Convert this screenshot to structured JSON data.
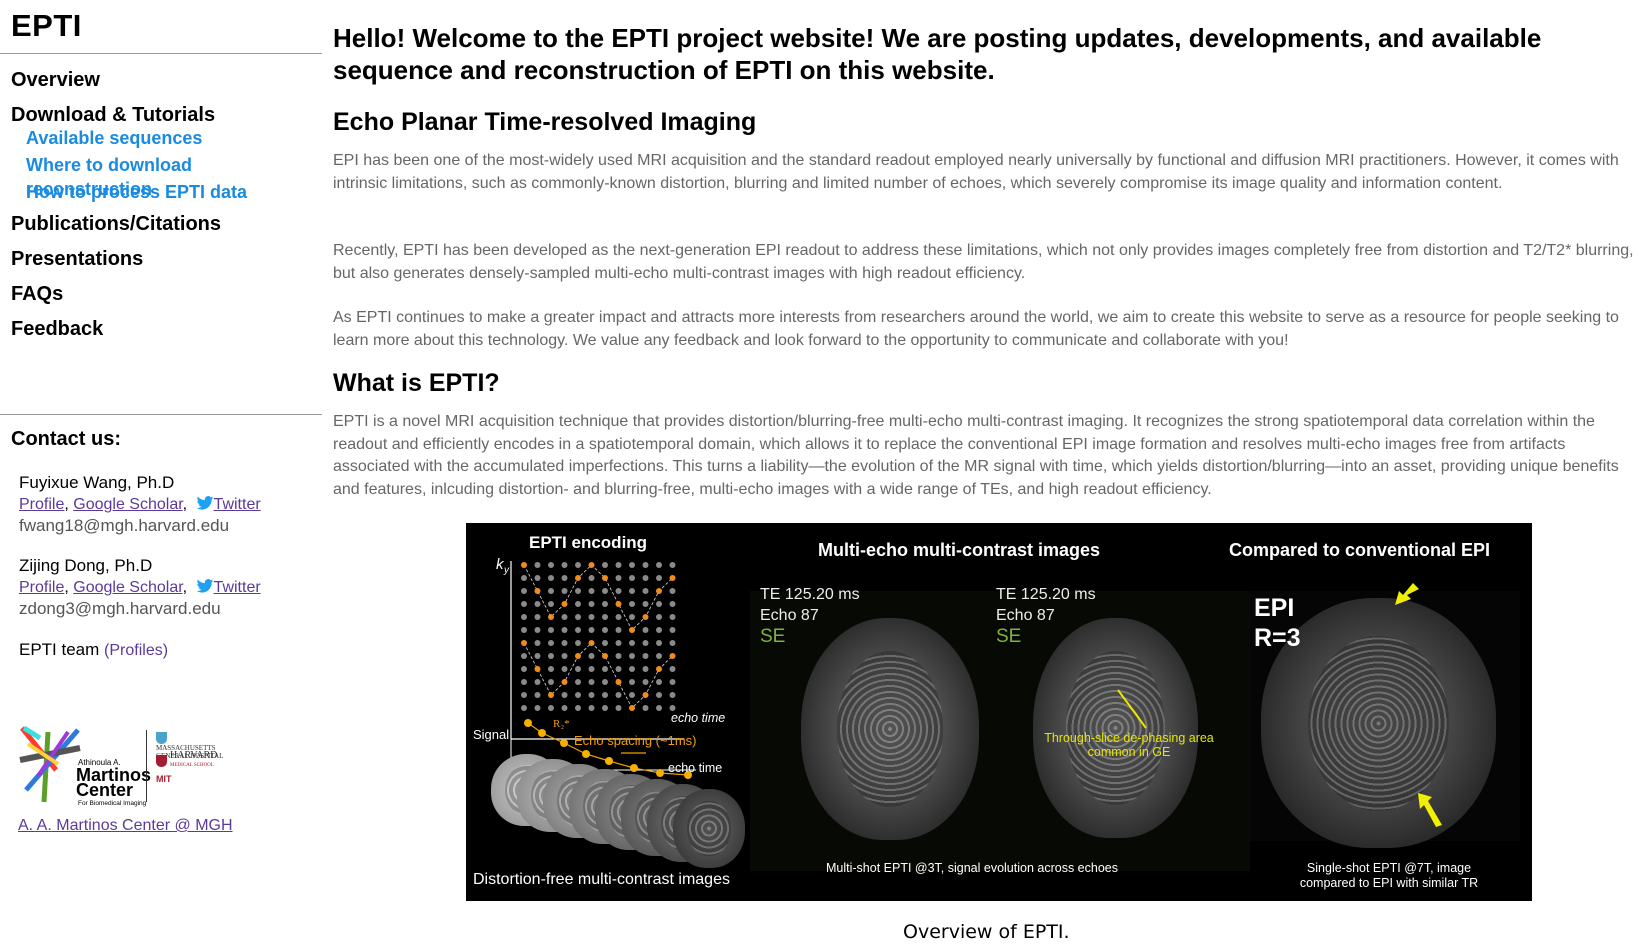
{
  "sidebar": {
    "site_title": "EPTI",
    "nav": [
      {
        "label": "Overview"
      },
      {
        "label": "Download & Tutorials"
      }
    ],
    "sub_nav": [
      {
        "label": "Available sequences"
      },
      {
        "label": "Where to download reconstruction"
      },
      {
        "label": "How to process EPTI data"
      }
    ],
    "nav_after": [
      {
        "label": "Publications/Citations"
      },
      {
        "label": "Presentations"
      },
      {
        "label": "FAQs"
      },
      {
        "label": "Feedback"
      }
    ],
    "contact_title": "Contact us:",
    "contacts": [
      {
        "name": "Fuyixue Wang, Ph.D",
        "profile": "Profile",
        "scholar": "Google Scholar",
        "twitter": "Twitter",
        "email": "fwang18@mgh.harvard.edu"
      },
      {
        "name": "Zijing Dong, Ph.D",
        "profile": "Profile",
        "scholar": "Google Scholar",
        "twitter": "Twitter",
        "email": "zdong3@mgh.harvard.edu"
      }
    ],
    "team_label": "EPTI team",
    "team_link": "(Profiles)",
    "logo": {
      "small": "Athinoula A.",
      "line1": "Martinos",
      "line2": "Center",
      "sub": "For Biomedical Imaging",
      "inst1a": "MASSACHUSETTS",
      "inst1b": "GENERAL HOSPITAL",
      "inst2a": "HARVARD",
      "inst2b": "MEDICAL SCHOOL",
      "inst3": "MIT"
    },
    "martinos_link": "A. A. Martinos Center @ MGH",
    "colors": {
      "link": "#5b3a99",
      "subnav": "#1a8be0",
      "twitter": "#1da1f2"
    }
  },
  "main": {
    "welcome": "Hello! Welcome to the EPTI project website! We are posting updates, developments, and available sequence and reconstruction of EPTI on this website.",
    "section1_title": "Echo Planar Time-resolved Imaging",
    "section1_paras": [
      "EPI has been one of the most-widely used MRI acquisition and the standard readout employed nearly universally by functional and diffusion MRI practitioners. However, it comes with intrinsic limitations, such as commonly-known distortion, blurring and limited number of echoes, which severely compromise its image quality and information content.",
      "Recently, EPTI has been developed as the next-generation EPI readout to address these limitations, which not only provides images completely free from distortion and T2/T2* blurring, but also generates densely-sampled multi-echo multi-contrast images with high readout efficiency.",
      "As EPTI continues to make a greater impact and attracts more interests from researchers around the world, we aim to create this website to serve as a resource for people seeking to learn more about this technology. We value any feedback and look forward to the opportunity to communicate and collaborate with you!"
    ],
    "section2_title": "What is EPTI?",
    "section2_para": "EPTI is a novel MRI acquisition technique that provides distortion/blurring-free multi-echo multi-contrast imaging. It recognizes the strong spatiotemporal data correlation within the readout and efficiently encodes in a spatiotemporal domain, which allows it to replace the conventional EPI image formation and resolves multi-echo images free from artifacts associated with the accumulated imperfections. This turns a liability—the evolution of the MR signal with time, which yields distortion/blurring—into an asset, providing unique benefits and features, inlcuding distortion- and blurring-free, multi-echo images with a wide range of TEs, and high readout efficiency.",
    "figure": {
      "encoding_title": "EPTI encoding",
      "ky_label": "ky",
      "echo_time_label": "echo time",
      "signal_label": "Signal",
      "r2_label": "R2*",
      "echo_spacing": "Echo spacing (~1ms)",
      "distortion_caption": "Distortion-free multi-contrast images",
      "multi_title": "Multi-echo multi-contrast images",
      "te_value": "TE 125.20 ms",
      "echo_value": "Echo 87",
      "se_label": "SE",
      "dephasing_note": "Through-slice de-phasing area common in GE",
      "multi_caption": "Multi-shot EPTI @3T, signal evolution across echoes",
      "compare_title": "Compared to conventional EPI",
      "epi_label1": "EPI",
      "epi_label2": "R=3",
      "compare_caption1": "Single-shot EPTI @7T, image",
      "compare_caption2": "compared to EPI with similar TR"
    },
    "figure_caption": "Overview of EPTI."
  }
}
